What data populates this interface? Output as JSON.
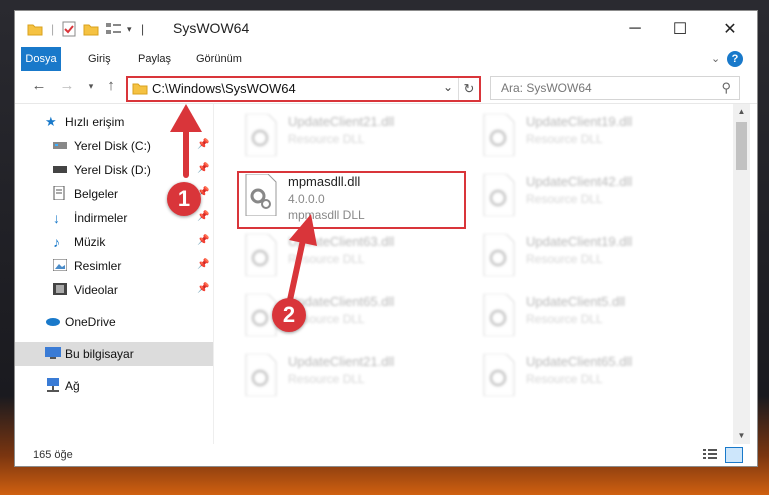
{
  "window": {
    "title": "SysWOW64"
  },
  "ribbon": {
    "tabs": [
      "Dosya",
      "Giriş",
      "Paylaş",
      "Görünüm"
    ]
  },
  "address": {
    "path": "C:\\Windows\\SysWOW64"
  },
  "search": {
    "placeholder": "Ara: SysWOW64"
  },
  "sidebar": {
    "items": [
      {
        "label": "Hızlı erişim",
        "icon": "star-icon"
      },
      {
        "label": "Yerel Disk (C:)",
        "icon": "drive-icon",
        "pinned": true
      },
      {
        "label": "Yerel Disk (D:)",
        "icon": "drive-icon",
        "pinned": true
      },
      {
        "label": "Belgeler",
        "icon": "documents-icon",
        "pinned": true
      },
      {
        "label": "İndirmeler",
        "icon": "downloads-icon",
        "pinned": true
      },
      {
        "label": "Müzik",
        "icon": "music-icon",
        "pinned": true
      },
      {
        "label": "Resimler",
        "icon": "pictures-icon",
        "pinned": true
      },
      {
        "label": "Videolar",
        "icon": "videos-icon",
        "pinned": true
      },
      {
        "label": "OneDrive",
        "icon": "cloud-icon"
      },
      {
        "label": "Bu bilgisayar",
        "icon": "computer-icon",
        "selected": true
      },
      {
        "label": "Ağ",
        "icon": "network-icon"
      }
    ]
  },
  "files": {
    "highlighted": {
      "name": "mpmasdll.dll",
      "version": "4.0.0.0",
      "description": "mpmasdll DLL"
    },
    "left": [
      {
        "name": "UpdateClient21.dll",
        "type": "Resource DLL"
      },
      {
        "name": "UpdateClient63.dll",
        "type": "Resource DLL"
      },
      {
        "name": "UpdateClient65.dll",
        "type": "Resource DLL"
      },
      {
        "name": "UpdateClient21.dll",
        "type": "Resource DLL"
      }
    ],
    "right": [
      {
        "name": "UpdateClient19.dll",
        "type": "Resource DLL"
      },
      {
        "name": "UpdateClient42.dll",
        "type": "Resource DLL"
      },
      {
        "name": "UpdateClient19.dll",
        "type": "Resource DLL"
      },
      {
        "name": "UpdateClient5.dll",
        "type": "Resource DLL"
      },
      {
        "name": "UpdateClient65.dll",
        "type": "Resource DLL"
      }
    ]
  },
  "status": {
    "count": "165 öğe"
  },
  "annotations": {
    "step1": "1",
    "step2": "2"
  },
  "colors": {
    "accent": "#1979ca",
    "highlight": "#d9353a"
  }
}
